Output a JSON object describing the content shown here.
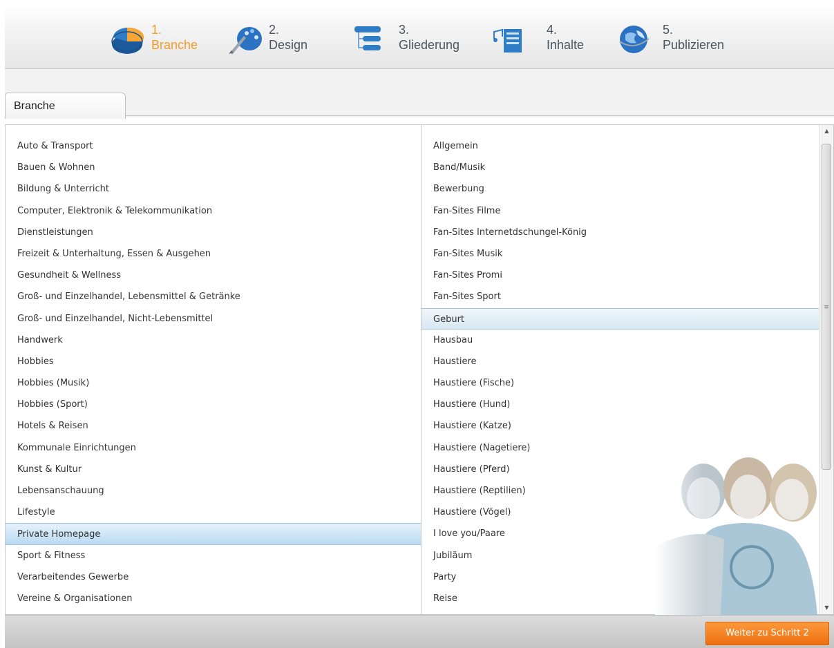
{
  "wizard": {
    "steps": [
      {
        "number": "1.",
        "label": "Branche",
        "icon": "pie-chart-icon",
        "active": true
      },
      {
        "number": "2.",
        "label": "Design",
        "icon": "palette-brush-icon",
        "active": false
      },
      {
        "number": "3.",
        "label": "Gliederung",
        "icon": "structure-tree-icon",
        "active": false
      },
      {
        "number": "4.",
        "label": "Inhalte",
        "icon": "content-document-icon",
        "active": false
      },
      {
        "number": "5.",
        "label": "Publizieren",
        "icon": "globe-publish-icon",
        "active": false
      }
    ]
  },
  "tab": {
    "label": "Branche"
  },
  "categories": {
    "selected": "Private Homepage",
    "items": [
      "Auto & Transport",
      "Bauen & Wohnen",
      "Bildung & Unterricht",
      "Computer, Elektronik & Telekommunikation",
      "Dienstleistungen",
      "Freizeit & Unterhaltung, Essen & Ausgehen",
      "Gesundheit & Wellness",
      "Groß- und Einzelhandel, Lebensmittel & Getränke",
      "Groß- und Einzelhandel, Nicht-Lebensmittel",
      "Handwerk",
      "Hobbies",
      "Hobbies (Musik)",
      "Hobbies (Sport)",
      "Hotels & Reisen",
      "Kommunale Einrichtungen",
      "Kunst & Kultur",
      "Lebensanschauung",
      "Lifestyle",
      "Private Homepage",
      "Sport & Fitness",
      "Verarbeitendes Gewerbe",
      "Vereine & Organisationen"
    ]
  },
  "subcategories": {
    "selected": "Geburt",
    "items": [
      "Allgemein",
      "Band/Musik",
      "Bewerbung",
      "Fan-Sites Filme",
      "Fan-Sites Internetdschungel-König",
      "Fan-Sites Musik",
      "Fan-Sites Promi",
      "Fan-Sites Sport",
      "Geburt",
      "Hausbau",
      "Haustiere",
      "Haustiere (Fische)",
      "Haustiere (Hund)",
      "Haustiere (Katze)",
      "Haustiere (Nagetiere)",
      "Haustiere (Pferd)",
      "Haustiere (Reptilien)",
      "Haustiere (Vögel)",
      "I love you/Paare",
      "Jubiläum",
      "Party",
      "Reise"
    ]
  },
  "scrollbar": {
    "up_arrow": "▲",
    "down_arrow": "▼",
    "grip": "≡"
  },
  "footer": {
    "next_button": "Weiter zu Schritt 2"
  },
  "colors": {
    "accent": "#f39a2b",
    "button": "#f47f20",
    "selection": "#c4def2"
  }
}
